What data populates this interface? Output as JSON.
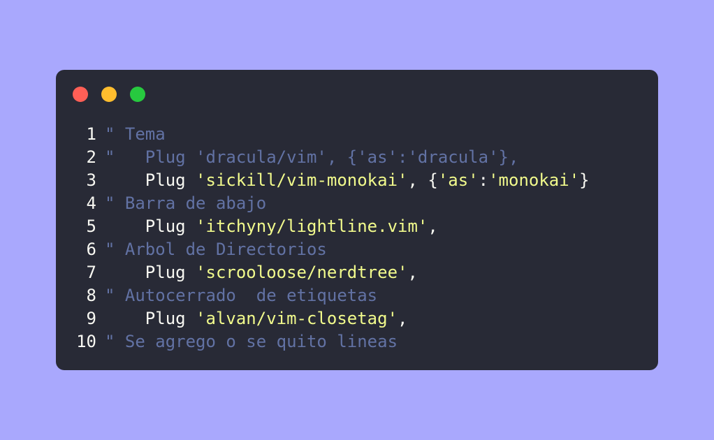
{
  "window": {
    "controls": [
      {
        "name": "close",
        "color": "#ff5f56"
      },
      {
        "name": "minimize",
        "color": "#ffbd2e"
      },
      {
        "name": "maximize",
        "color": "#27c93f"
      }
    ]
  },
  "editor": {
    "lines": [
      {
        "number": "1",
        "tokens": [
          {
            "type": "comment",
            "text": "\" Tema"
          }
        ]
      },
      {
        "number": "2",
        "tokens": [
          {
            "type": "comment",
            "text": "\"   Plug 'dracula/vim', {'as':'dracula'},"
          }
        ]
      },
      {
        "number": "3",
        "tokens": [
          {
            "type": "plain",
            "text": "    Plug "
          },
          {
            "type": "string",
            "text": "'sickill/vim-monokai'"
          },
          {
            "type": "plain",
            "text": ", {"
          },
          {
            "type": "string",
            "text": "'as'"
          },
          {
            "type": "plain",
            "text": ":"
          },
          {
            "type": "string",
            "text": "'monokai'"
          },
          {
            "type": "plain",
            "text": "}"
          }
        ]
      },
      {
        "number": "4",
        "tokens": [
          {
            "type": "comment",
            "text": "\" Barra de abajo"
          }
        ]
      },
      {
        "number": "5",
        "tokens": [
          {
            "type": "plain",
            "text": "    Plug "
          },
          {
            "type": "string",
            "text": "'itchyny/lightline.vim'"
          },
          {
            "type": "plain",
            "text": ","
          }
        ]
      },
      {
        "number": "6",
        "tokens": [
          {
            "type": "comment",
            "text": "\" Arbol de Directorios"
          }
        ]
      },
      {
        "number": "7",
        "tokens": [
          {
            "type": "plain",
            "text": "    Plug "
          },
          {
            "type": "string",
            "text": "'scrooloose/nerdtree'"
          },
          {
            "type": "plain",
            "text": ","
          }
        ]
      },
      {
        "number": "8",
        "tokens": [
          {
            "type": "comment",
            "text": "\" Autocerrado  de etiquetas"
          }
        ]
      },
      {
        "number": "9",
        "tokens": [
          {
            "type": "plain",
            "text": "    Plug "
          },
          {
            "type": "string",
            "text": "'alvan/vim-closetag'"
          },
          {
            "type": "plain",
            "text": ","
          }
        ]
      },
      {
        "number": "10",
        "tokens": [
          {
            "type": "comment",
            "text": "\" Se agrego o se quito lineas"
          }
        ]
      }
    ]
  }
}
